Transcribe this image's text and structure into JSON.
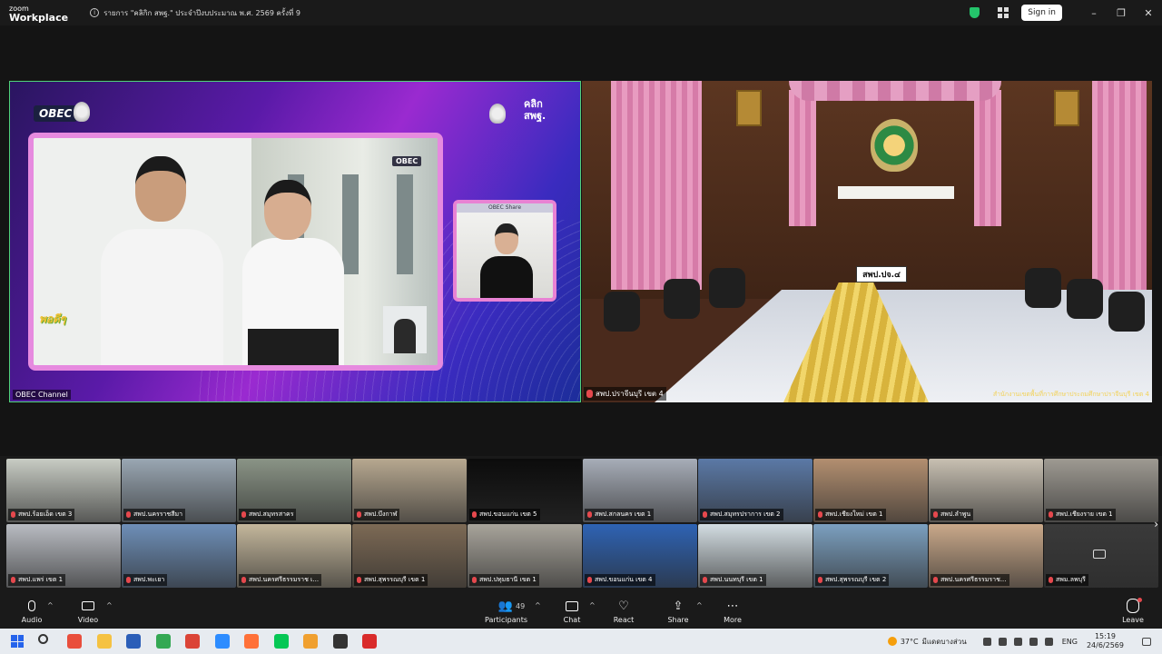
{
  "window": {
    "brand_top": "zoom",
    "brand_bottom": "Workplace",
    "meeting_title": "รายการ \"คลิกิก สพฐ.\" ประจำปีงบประมาณ พ.ศ. 2569 ครั้งที่ 9",
    "signin_label": "Sign in",
    "minimize": "–",
    "restore": "❐",
    "close": "✕"
  },
  "main_left": {
    "label": "OBEC Channel",
    "brand_logo": "OBEC",
    "small_logo": "OBEC",
    "overlay_logo": "พอดีๆ",
    "klik_logo_top": "คลิก",
    "klik_logo_bottom": "สพฐ.",
    "presenter_banner": "OBEC Share"
  },
  "main_right": {
    "label": "สพป.ปราจีนบุรี เขต 4",
    "name_plate": "สพป.ปจ.๔",
    "caption": "สำนักงานเขตพื้นที่การศึกษาประถมศึกษาปราจีนบุรี เขต 4"
  },
  "gallery": [
    {
      "label": "สพป.ร้อยเอ็ด เขต 3",
      "bg": "#c8ccc4"
    },
    {
      "label": "สพป.นครราชสีมา",
      "bg": "#9aa7b3"
    },
    {
      "label": "สพป.สมุทรสาคร",
      "bg": "#8a9486"
    },
    {
      "label": "สพป.บึงกาฬ",
      "bg": "#b7a890"
    },
    {
      "label": "สพป.ขอนแก่น เขต 5",
      "bg": "#0c0c0c"
    },
    {
      "label": "สพป.สกลนคร เขต 1",
      "bg": "#a7adb8"
    },
    {
      "label": "สพป.สมุทรปราการ เขต 2",
      "bg": "#5b79a6"
    },
    {
      "label": "สพป.เชียงใหม่ เขต 1",
      "bg": "#b38f70"
    },
    {
      "label": "สพป.ลำพูน",
      "bg": "#c8c0b2"
    },
    {
      "label": "สพป.เชียงราย เขต 1",
      "bg": "#9e9a92"
    },
    {
      "label": "สพป.แพร่ เขต 1",
      "bg": "#b9bcc2"
    },
    {
      "label": "สพป.พะเยา",
      "bg": "#6e8fb8"
    },
    {
      "label": "สพป.นครศรีธรรมราช เ...",
      "bg": "#c4b79c"
    },
    {
      "label": "สพป.สุพรรณบุรี เขต 1",
      "bg": "#7d6a55"
    },
    {
      "label": "สพป.ปทุมธานี เขต 1",
      "bg": "#a8a49b"
    },
    {
      "label": "สพป.ขอนแก่น เขต 4",
      "bg": "#2e63b4"
    },
    {
      "label": "สพป.นนทบุรี เขต 1",
      "bg": "#d3dde2"
    },
    {
      "label": "สพป.สุพรรณบุรี เขต 2",
      "bg": "#7ca0c0"
    },
    {
      "label": "สพป.นครศรีธรรมราช...",
      "bg": "#caa98a"
    },
    {
      "label": "สพม.ลพบุรี",
      "bg": "#3a3a3a"
    }
  ],
  "gallery_next": "›",
  "toolbar": {
    "audio": "Audio",
    "video": "Video",
    "participants": "Participants",
    "participants_count": "49",
    "chat": "Chat",
    "react": "React",
    "share": "Share",
    "more": "More",
    "leave": "Leave",
    "caret": "^"
  },
  "taskbar": {
    "temperature": "37°C",
    "weather_text": "มีแดดบางส่วน",
    "lang": "ENG",
    "time": "15:19",
    "date": "24/6/2569",
    "apps": [
      {
        "name": "s-app-icon",
        "color": "#e94e3c"
      },
      {
        "name": "file-explorer-icon",
        "color": "#f5c242"
      },
      {
        "name": "word-icon",
        "color": "#2b5eb8"
      },
      {
        "name": "drive-icon",
        "color": "#34a853"
      },
      {
        "name": "chrome-icon",
        "color": "#db4437"
      },
      {
        "name": "zoom-app-icon",
        "color": "#2d8cff"
      },
      {
        "name": "firefox-icon",
        "color": "#ff7139"
      },
      {
        "name": "line-icon",
        "color": "#06c755"
      },
      {
        "name": "orange-app-icon",
        "color": "#f0a030"
      },
      {
        "name": "capture-app-icon",
        "color": "#333333"
      },
      {
        "name": "acrobat-icon",
        "color": "#d92b2b"
      }
    ]
  },
  "colors": {
    "active_speaker_border": "#4fd27a",
    "mute_red": "#e5484d",
    "shield_green": "#24c46b"
  }
}
